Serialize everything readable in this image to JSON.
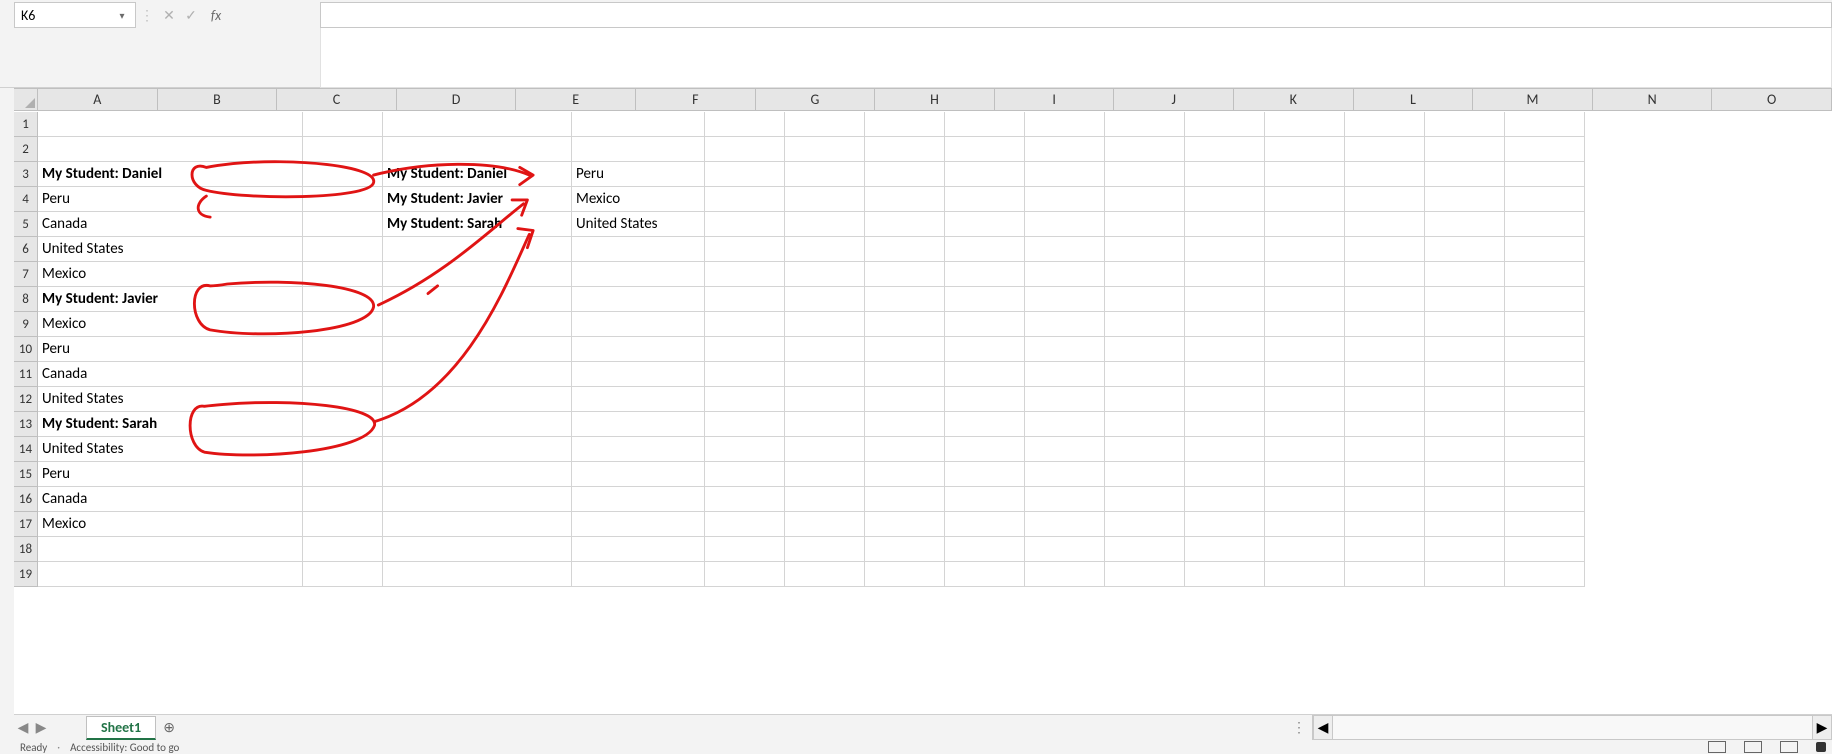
{
  "formula_bar": {
    "name_box": "K6",
    "caret": "▾",
    "sep": "⋮",
    "cancel": "✕",
    "accept": "✓",
    "fx": "fx",
    "formula": ""
  },
  "columns": [
    "",
    "A",
    "B",
    "C",
    "D",
    "E",
    "F",
    "G",
    "H",
    "I",
    "J",
    "K",
    "L",
    "M",
    "N",
    "O"
  ],
  "row_count": 19,
  "cells": {
    "A3": {
      "text": "My Student: Daniel",
      "bold": true
    },
    "A4": {
      "text": "Peru"
    },
    "A5": {
      "text": "Canada"
    },
    "A6": {
      "text": "United States"
    },
    "A7": {
      "text": "Mexico"
    },
    "A8": {
      "text": "My Student: Javier",
      "bold": true
    },
    "A9": {
      "text": "Mexico"
    },
    "A10": {
      "text": "Peru"
    },
    "A11": {
      "text": "Canada"
    },
    "A12": {
      "text": "United States"
    },
    "A13": {
      "text": "My Student: Sarah",
      "bold": true
    },
    "A14": {
      "text": "United States"
    },
    "A15": {
      "text": "Peru"
    },
    "A16": {
      "text": "Canada"
    },
    "A17": {
      "text": "Mexico"
    },
    "C3": {
      "text": "My Student: Daniel",
      "bold": true
    },
    "C4": {
      "text": "My Student: Javier",
      "bold": true
    },
    "C5": {
      "text": "My Student: Sarah",
      "bold": true
    },
    "D3": {
      "text": "Peru"
    },
    "D4": {
      "text": "Mexico"
    },
    "D5": {
      "text": "United States"
    }
  },
  "sheet_tab": {
    "prev": "◀",
    "next": "▶",
    "name": "Sheet1",
    "add": "⊕",
    "dots": "⋮",
    "scroll_left": "◀",
    "scroll_right": "▶"
  },
  "status": {
    "ready": "Ready",
    "accessibility": "Accessibility: Good to go"
  }
}
